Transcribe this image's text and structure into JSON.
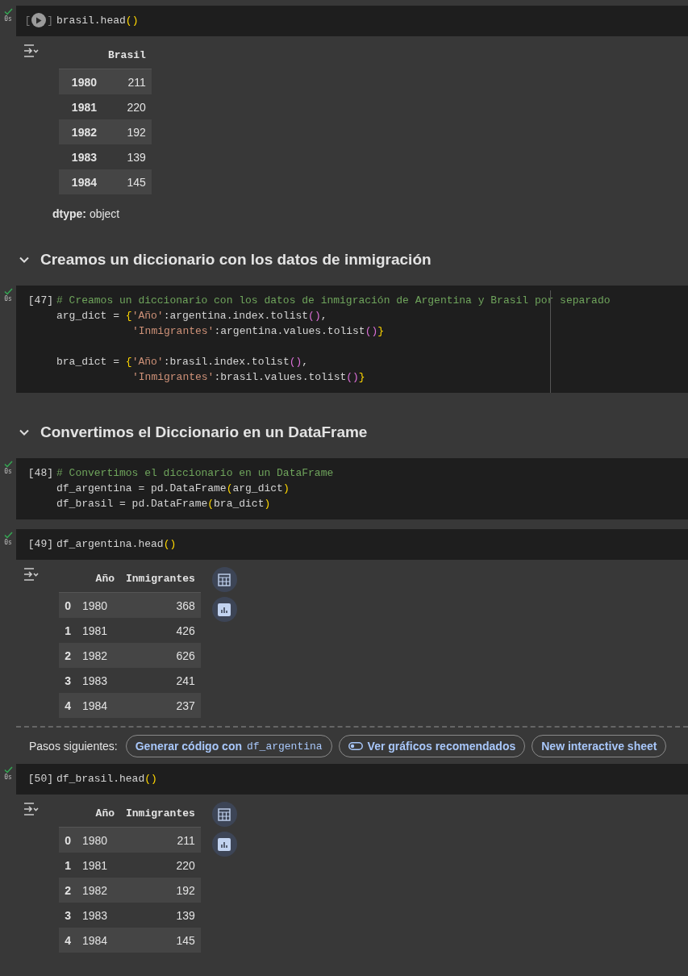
{
  "cells": [
    {
      "kind": "code",
      "run_button": true,
      "prompt_open": "[",
      "prompt_close": "]",
      "time": "0s",
      "done": true,
      "ruler": false,
      "lines": [
        {
          "tokens": [
            {
              "kind": "plain",
              "text": "brasil.head"
            },
            {
              "kind": "paren1",
              "text": "()"
            }
          ]
        }
      ],
      "output": {
        "kind": "series",
        "columns": [
          "",
          "Brasil"
        ],
        "rows": [
          [
            "1980",
            "211"
          ],
          [
            "1981",
            "220"
          ],
          [
            "1982",
            "192"
          ],
          [
            "1983",
            "139"
          ],
          [
            "1984",
            "145"
          ]
        ],
        "dtype_label": "dtype:",
        "dtype_value": "object"
      }
    },
    {
      "kind": "heading",
      "text": "Creamos un diccionario con los datos de inmigración",
      "expanded": true
    },
    {
      "kind": "code",
      "run_button": false,
      "prompt": "[47]",
      "time": "0s",
      "done": true,
      "ruler": true,
      "lines": [
        {
          "tokens": [
            {
              "kind": "comment",
              "text": "# Creamos un diccionario con los datos de inmigración de Argentina y Brasil por separado"
            }
          ]
        },
        {
          "tokens": [
            {
              "kind": "plain",
              "text": "arg_dict = "
            },
            {
              "kind": "paren1",
              "text": "{"
            },
            {
              "kind": "string",
              "text": "'Año'"
            },
            {
              "kind": "plain",
              "text": ":argentina.index.tolist"
            },
            {
              "kind": "paren2",
              "text": "()"
            },
            {
              "kind": "plain",
              "text": ","
            }
          ]
        },
        {
          "indent": true,
          "tokens": [
            {
              "kind": "string",
              "text": "'Inmigrantes'"
            },
            {
              "kind": "plain",
              "text": ":argentina.values.tolist"
            },
            {
              "kind": "paren2",
              "text": "()"
            },
            {
              "kind": "paren1",
              "text": "}"
            }
          ]
        },
        {
          "gap_before": true,
          "tokens": [
            {
              "kind": "plain",
              "text": "bra_dict = "
            },
            {
              "kind": "paren1",
              "text": "{"
            },
            {
              "kind": "string",
              "text": "'Año'"
            },
            {
              "kind": "plain",
              "text": ":brasil.index.tolist"
            },
            {
              "kind": "paren2",
              "text": "()"
            },
            {
              "kind": "plain",
              "text": ","
            }
          ]
        },
        {
          "indent": true,
          "tokens": [
            {
              "kind": "string",
              "text": "'Inmigrantes'"
            },
            {
              "kind": "plain",
              "text": ":brasil.values.tolist"
            },
            {
              "kind": "paren2",
              "text": "()"
            },
            {
              "kind": "paren1",
              "text": "}"
            }
          ]
        }
      ]
    },
    {
      "kind": "heading",
      "text": "Convertimos el Diccionario en un DataFrame",
      "expanded": true
    },
    {
      "kind": "code",
      "run_button": false,
      "prompt": "[48]",
      "time": "0s",
      "done": true,
      "ruler": false,
      "lines": [
        {
          "tokens": [
            {
              "kind": "comment",
              "text": "# Convertimos el diccionario en un DataFrame"
            }
          ]
        },
        {
          "tokens": [
            {
              "kind": "plain",
              "text": "df_argentina = pd.DataFrame"
            },
            {
              "kind": "paren1",
              "text": "("
            },
            {
              "kind": "plain",
              "text": "arg_dict"
            },
            {
              "kind": "paren1",
              "text": ")"
            }
          ]
        },
        {
          "tokens": [
            {
              "kind": "plain",
              "text": "df_brasil = pd.DataFrame"
            },
            {
              "kind": "paren1",
              "text": "("
            },
            {
              "kind": "plain",
              "text": "bra_dict"
            },
            {
              "kind": "paren1",
              "text": ")"
            }
          ]
        }
      ]
    },
    {
      "kind": "code",
      "run_button": false,
      "prompt": "[49]",
      "time": "0s",
      "done": true,
      "ruler": false,
      "lines": [
        {
          "tokens": [
            {
              "kind": "plain",
              "text": "df_argentina.head"
            },
            {
              "kind": "paren1",
              "text": "()"
            }
          ]
        }
      ],
      "output": {
        "kind": "dataframe",
        "columns": [
          "",
          "Año",
          "Inmigrantes"
        ],
        "rows": [
          [
            "0",
            "1980",
            "368"
          ],
          [
            "1",
            "1981",
            "426"
          ],
          [
            "2",
            "1982",
            "626"
          ],
          [
            "3",
            "1983",
            "241"
          ],
          [
            "4",
            "1984",
            "237"
          ]
        ]
      },
      "next_steps": {
        "label": "Pasos siguientes:",
        "buttons": [
          {
            "kind": "code",
            "text": "Generar código con ",
            "code": "df_argentina"
          },
          {
            "kind": "toggle",
            "text": "Ver gráficos recomendados"
          },
          {
            "kind": "plain",
            "text": "New interactive sheet"
          }
        ]
      }
    },
    {
      "kind": "code",
      "run_button": false,
      "prompt": "[50]",
      "time": "0s",
      "done": true,
      "ruler": false,
      "lines": [
        {
          "tokens": [
            {
              "kind": "plain",
              "text": "df_brasil.head"
            },
            {
              "kind": "paren1",
              "text": "()"
            }
          ]
        }
      ],
      "output": {
        "kind": "dataframe",
        "columns": [
          "",
          "Año",
          "Inmigrantes"
        ],
        "rows": [
          [
            "0",
            "1980",
            "211"
          ],
          [
            "1",
            "1981",
            "220"
          ],
          [
            "2",
            "1982",
            "192"
          ],
          [
            "3",
            "1983",
            "139"
          ],
          [
            "4",
            "1984",
            "145"
          ]
        ]
      }
    }
  ]
}
